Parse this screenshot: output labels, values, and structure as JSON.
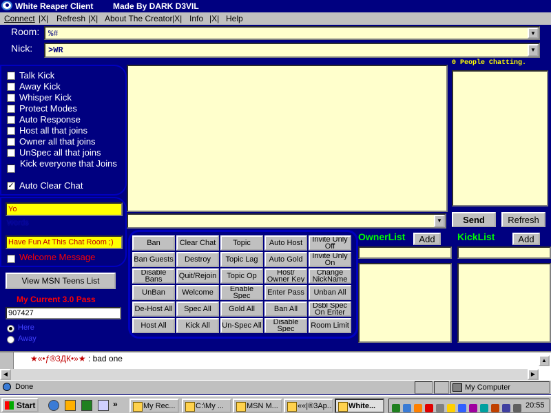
{
  "window": {
    "title": "White Reaper Client",
    "subtitle": "Made By DARK D3VIL"
  },
  "menu": [
    {
      "label": "Connect"
    },
    {
      "label": "Refresh"
    },
    {
      "label": "About The Creator"
    },
    {
      "label": "Info"
    },
    {
      "label": "Help"
    }
  ],
  "menu_separator": "|X|",
  "room": {
    "label": "Room:",
    "value": "%#"
  },
  "nick": {
    "label": "Nick:",
    "value": ">WR"
  },
  "options": [
    {
      "label": "Talk Kick",
      "checked": false
    },
    {
      "label": "Away Kick",
      "checked": false
    },
    {
      "label": "Whisper Kick",
      "checked": false
    },
    {
      "label": "Protect Modes",
      "checked": false
    },
    {
      "label": "Auto Response",
      "checked": false
    },
    {
      "label": "Host all that joins",
      "checked": false
    },
    {
      "label": "Owner all that joins",
      "checked": false
    },
    {
      "label": "UnSpec all that joins",
      "checked": false
    },
    {
      "label": "Kick everyone that Joins",
      "checked": false
    },
    {
      "label": "Auto Clear Chat",
      "checked": true
    }
  ],
  "response": {
    "value": "Yo",
    "label": "Words"
  },
  "welcome": {
    "value": "Have Fun At This Chat Room ;)",
    "label": "Welcome Message"
  },
  "view_list_button": "View MSN Teens List",
  "pass": {
    "label": "My Current 3.0 Pass",
    "value": "907427"
  },
  "status": {
    "here": "Here",
    "away": "Away"
  },
  "people_count": "0 People Chatting.",
  "send_button": "Send",
  "refresh_button": "Refresh",
  "grid_buttons": [
    [
      "Ban",
      "Clear Chat",
      "Topic",
      "Auto Host",
      "Invite Unly Off"
    ],
    [
      "Ban Guests",
      "Destroy",
      "Topic Lag",
      "Auto Gold",
      "Invite Unly On"
    ],
    [
      "Disable Bans",
      "Quit/Rejoin",
      "Topic Op",
      "Host/ Owner Key",
      "Change NickName"
    ],
    [
      "UnBan",
      "Welcome",
      "Enable Spec",
      "Enter Pass",
      "Unban All"
    ],
    [
      "De-Host All",
      "Spec All",
      "Gold All",
      "Ban All",
      "Dsbl Spec On Enter"
    ],
    [
      "Host All",
      "Kick All",
      "Un-Spec All",
      "Disable Spec",
      "Room Limit"
    ]
  ],
  "ownerlist": {
    "label": "OwnerList",
    "add": "Add"
  },
  "kicklist": {
    "label": "KickList",
    "add": "Add"
  },
  "log": {
    "line1_name": "★«•ƒ®3ДК•»★",
    "line1_text": " : bad one"
  },
  "statusbar": {
    "text": "Done",
    "zone": "My Computer"
  },
  "taskbar": {
    "start": "Start",
    "tasks": [
      "My Rec...",
      "C:\\My ...",
      "MSN M...",
      "««|®3Ap...",
      "White..."
    ],
    "clock": "20:55"
  },
  "colors": {
    "navy": "#000080",
    "cream": "#ffffcc",
    "yellow": "#ffff00",
    "green": "#00ff00",
    "red": "#ff0000"
  }
}
